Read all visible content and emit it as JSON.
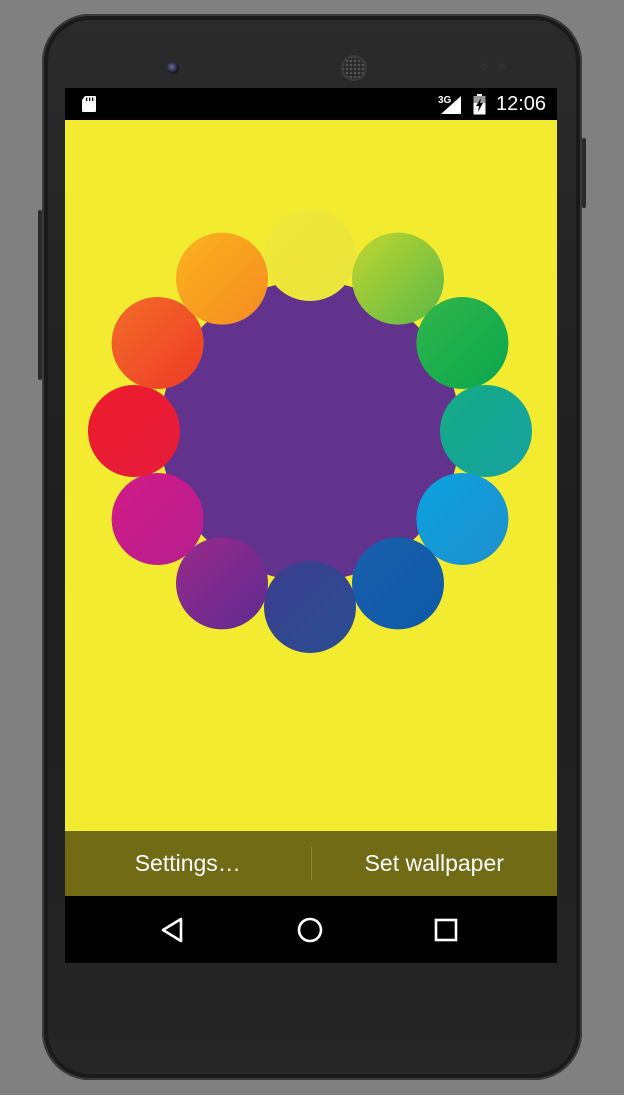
{
  "status_bar": {
    "network": "3G",
    "time": "12:06"
  },
  "colors": {
    "wallpaper_background": "#f3eb2f",
    "wheel_center": "#61338c",
    "action_bar": "#716b16",
    "circles": [
      [
        "#f1e83a",
        "#e9e53c"
      ],
      [
        "#c2d630",
        "#5cb847"
      ],
      [
        "#32b44a",
        "#0aa84f"
      ],
      [
        "#17ab83",
        "#15a2a2"
      ],
      [
        "#0aa3e0",
        "#1f8fcb"
      ],
      [
        "#1a5fab",
        "#0e5aa8"
      ],
      [
        "#3b3d8e",
        "#2b4e92"
      ],
      [
        "#9a2a8c",
        "#5c2c8e"
      ],
      [
        "#d21b86",
        "#b51f8f"
      ],
      [
        "#ee1c2c",
        "#e51c3d"
      ],
      [
        "#f26d2a",
        "#ee3a26"
      ],
      [
        "#fbb21e",
        "#f58c22"
      ]
    ]
  },
  "icons": {
    "sd_card": "sd-card-icon",
    "signal": "cell-signal-icon",
    "battery": "battery-charging-icon",
    "back": "back-icon",
    "home": "home-icon",
    "recents": "recents-icon"
  },
  "action_bar": {
    "settings_label": "Settings…",
    "set_wallpaper_label": "Set wallpaper"
  }
}
